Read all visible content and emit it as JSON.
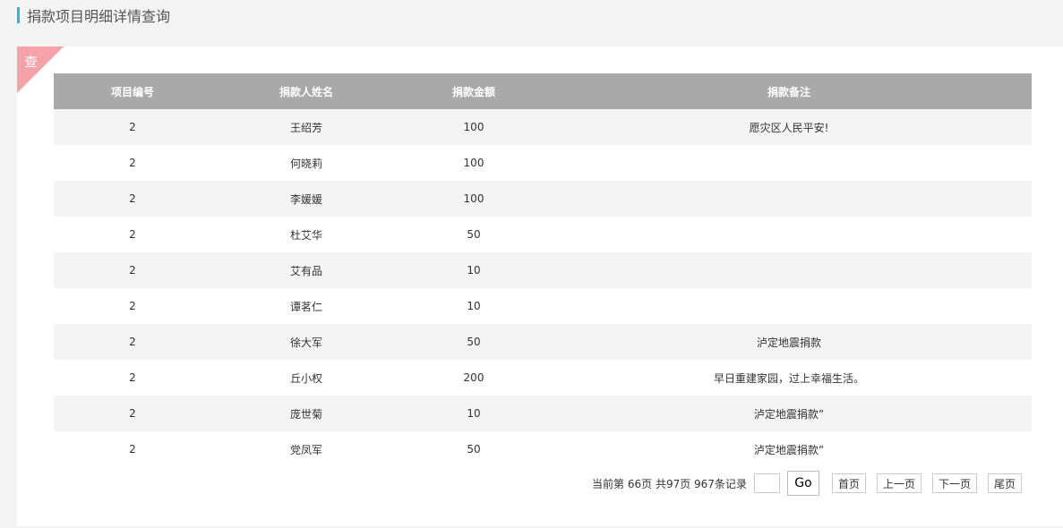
{
  "header": {
    "title": "捐款项目明细详情查询"
  },
  "corner": {
    "label": "查"
  },
  "table": {
    "columns": [
      "项目编号",
      "捐款人姓名",
      "捐款金额",
      "捐款备注"
    ],
    "rows": [
      [
        "2",
        "王绍芳",
        "100",
        "愿灾区人民平安!"
      ],
      [
        "2",
        "何晓莉",
        "100",
        ""
      ],
      [
        "2",
        "李媛媛",
        "100",
        ""
      ],
      [
        "2",
        "杜艾华",
        "50",
        ""
      ],
      [
        "2",
        "艾有品",
        "10",
        ""
      ],
      [
        "2",
        "谭茗仁",
        "10",
        ""
      ],
      [
        "2",
        "徐大军",
        "50",
        "泸定地震捐款"
      ],
      [
        "2",
        "丘小权",
        "200",
        "早日重建家园，过上幸福生活。"
      ],
      [
        "2",
        "庞世菊",
        "10",
        "泸定地震捐款”"
      ],
      [
        "2",
        "党凤军",
        "50",
        "泸定地震捐款”"
      ]
    ]
  },
  "pager": {
    "info": "当前第 66页  共97页  967条记录",
    "input_value": "",
    "go_label": "Go",
    "first_label": "首页",
    "prev_label": "上一页",
    "next_label": "下一页",
    "last_label": "尾页"
  }
}
